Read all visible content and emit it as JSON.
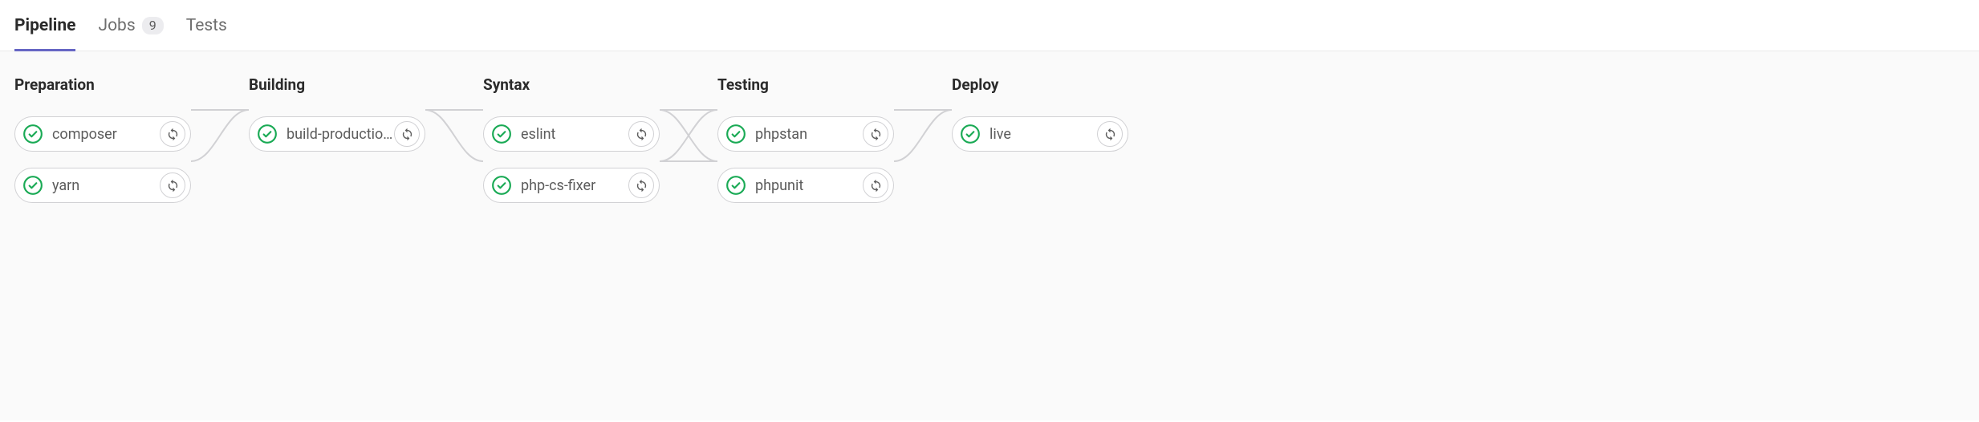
{
  "tabs": {
    "pipeline": "Pipeline",
    "jobs": "Jobs",
    "jobs_count": "9",
    "tests": "Tests"
  },
  "stages": [
    {
      "title": "Preparation",
      "jobs": [
        {
          "name": "composer",
          "status": "passed"
        },
        {
          "name": "yarn",
          "status": "passed"
        }
      ]
    },
    {
      "title": "Building",
      "jobs": [
        {
          "name": "build-productio…",
          "status": "passed"
        }
      ]
    },
    {
      "title": "Syntax",
      "jobs": [
        {
          "name": "eslint",
          "status": "passed"
        },
        {
          "name": "php-cs-fixer",
          "status": "passed"
        }
      ]
    },
    {
      "title": "Testing",
      "jobs": [
        {
          "name": "phpstan",
          "status": "passed"
        },
        {
          "name": "phpunit",
          "status": "passed"
        }
      ]
    },
    {
      "title": "Deploy",
      "jobs": [
        {
          "name": "live",
          "status": "passed"
        }
      ]
    }
  ],
  "colors": {
    "passed": "#1aaa55",
    "border": "#d1d1d4",
    "active_tab": "#6666c4"
  }
}
